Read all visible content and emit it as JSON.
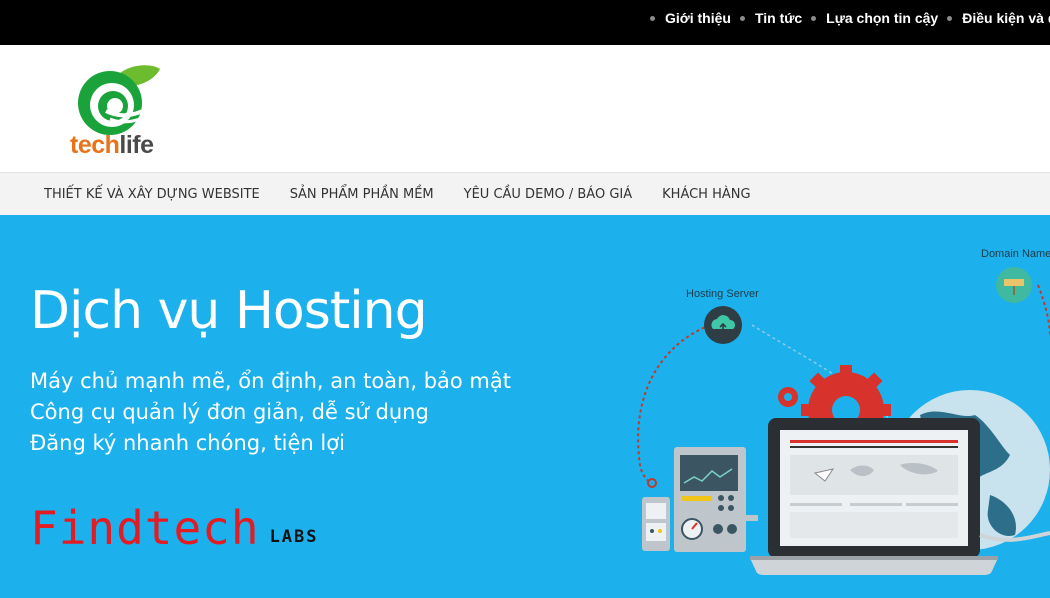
{
  "topnav": {
    "items": [
      "Giới thiệu",
      "Tin tức",
      "Lựa chọn tin cậy",
      "Điều kiện và quy"
    ]
  },
  "logo": {
    "text_part1": "tech",
    "text_part2": "life",
    "colors": {
      "green": "#1aa33b",
      "orange": "#e8731c",
      "gray": "#4a4a4a"
    }
  },
  "mainnav": {
    "items": [
      "THIẾT KẾ VÀ XÂY DỰNG WEBSITE",
      "SẢN PHẨM PHẦN MỀM",
      "YÊU CẦU DEMO / BÁO GIÁ",
      "KHÁCH HÀNG"
    ]
  },
  "hero": {
    "title": "Dịch vụ Hosting",
    "lines": [
      "Máy chủ mạnh mẽ, ổn định, an toàn, bảo mật",
      "Công cụ quản lý đơn giản, dễ sử dụng",
      "Đăng ký nhanh chóng, tiện lợi"
    ],
    "brand": "Findtech",
    "brand_suffix": "LABS",
    "illustration": {
      "hosting_label": "Hosting Server",
      "domain_label": "Domain Name"
    },
    "colors": {
      "background": "#1cb1ec",
      "brand_red": "#e31b23"
    }
  }
}
